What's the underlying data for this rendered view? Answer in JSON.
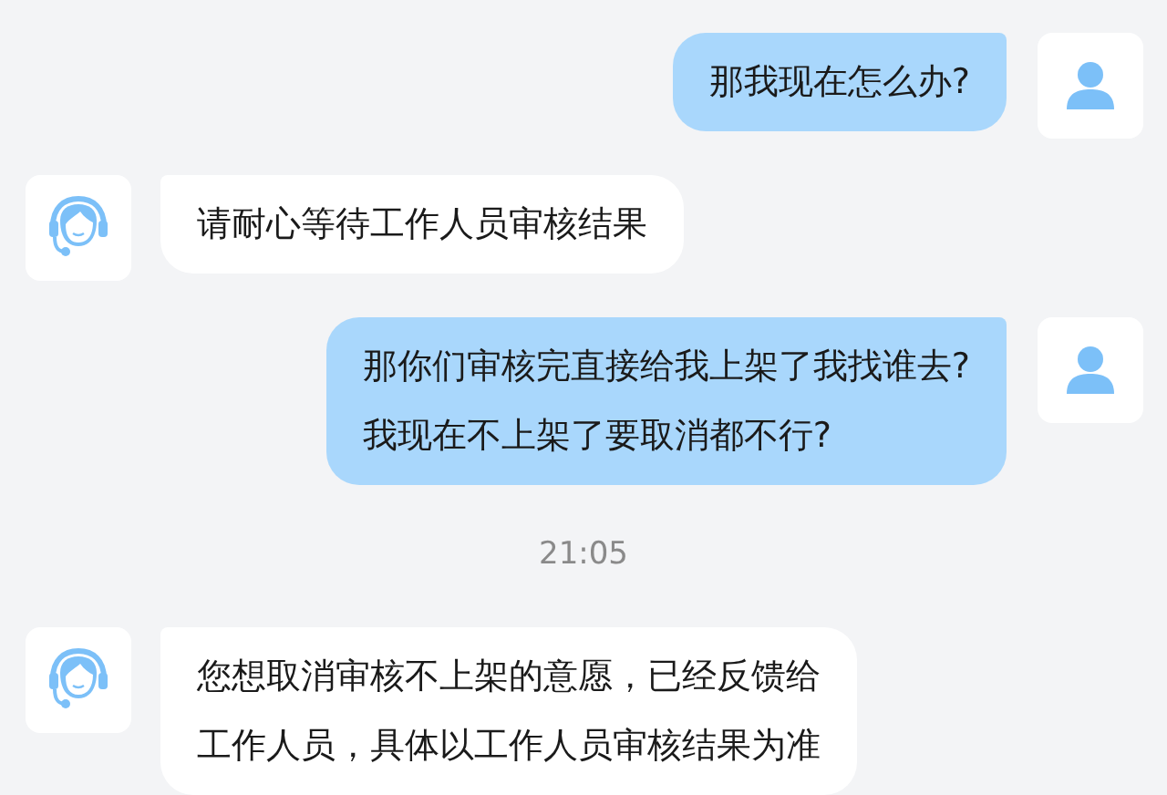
{
  "messages": [
    {
      "kind": "user",
      "lines": [
        "那我现在怎么办?"
      ]
    },
    {
      "kind": "agent",
      "lines": [
        "请耐心等待工作人员审核结果"
      ]
    },
    {
      "kind": "user",
      "lines": [
        "那你们审核完直接给我上架了我找谁去?",
        "我现在不上架了要取消都不行?"
      ]
    },
    {
      "kind": "time",
      "text": "21:05"
    },
    {
      "kind": "agent",
      "lines": [
        "您想取消审核不上架的意愿，已经反馈给",
        "工作人员，具体以工作人员审核结果为准"
      ]
    }
  ]
}
